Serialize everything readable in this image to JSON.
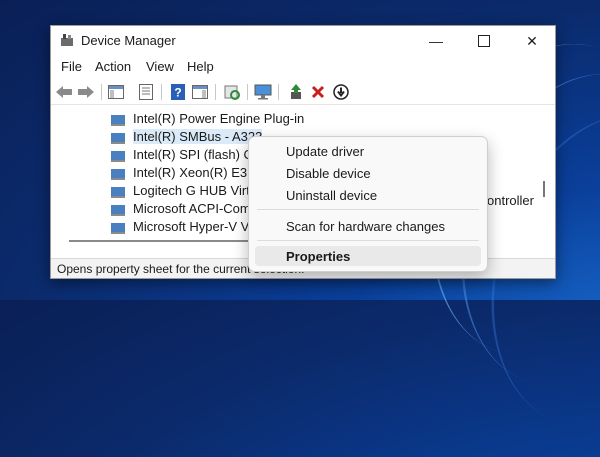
{
  "window": {
    "title": "Device Manager",
    "controls": {
      "minimize": "—",
      "close": "✕"
    }
  },
  "menubar": {
    "items": [
      "File",
      "Action",
      "View",
      "Help"
    ]
  },
  "toolbar": {
    "icons": [
      "back-arrow-icon",
      "forward-arrow-icon",
      "show-hide-console-tree-icon",
      "properties-sheet-icon",
      "help-icon",
      "action-pane-icon",
      "scan-hardware-icon",
      "monitor-icon",
      "update-driver-icon",
      "uninstall-device-icon",
      "disable-device-icon"
    ]
  },
  "tree": {
    "rows": [
      {
        "label": "Intel(R) Power Engine Plug-in"
      },
      {
        "label": "Intel(R) SMBus - A323",
        "selected": true
      },
      {
        "label": "Intel(R) SPI (flash) Cor"
      },
      {
        "label": "Intel(R) Xeon(R) E3 - 1"
      },
      {
        "label": "Logitech G HUB Virtu"
      },
      {
        "label": "Microsoft ACPI-Comp"
      },
      {
        "label": "Microsoft Hyper-V Vir"
      }
    ],
    "overflow_text": "ontroller"
  },
  "statusbar": {
    "text": "Opens property sheet for the current selection."
  },
  "context_menu": {
    "items": [
      {
        "label": "Update driver"
      },
      {
        "label": "Disable device"
      },
      {
        "label": "Uninstall device"
      },
      {
        "label": "Scan for hardware changes"
      },
      {
        "label": "Properties",
        "bold": true
      }
    ]
  },
  "colors": {
    "selection": "#dbeaf8",
    "uninstall_red": "#c81e1e",
    "update_green": "#2e8b3a",
    "help_blue": "#2a5fb8"
  }
}
